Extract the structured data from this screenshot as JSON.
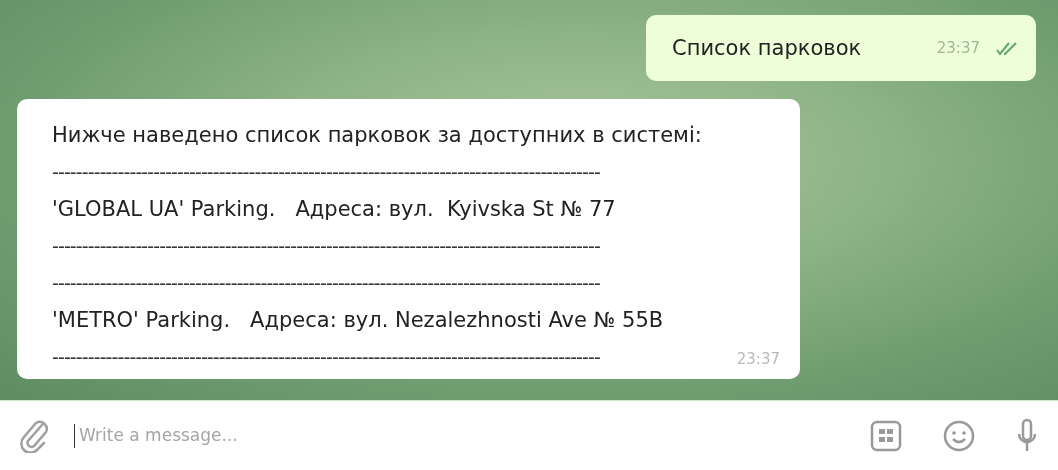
{
  "messages": [
    {
      "kind": "outgoing",
      "lines": [
        "Список парковок"
      ],
      "time": "23:37",
      "read": true
    },
    {
      "kind": "incoming",
      "lines": [
        "Нижче наведено список парковок за доступних в системі:",
        "--------------------------------------------------------------------------------------------",
        "'GLOBAL UA' Parking.   Адреса: вул.  Kyivska St № 77",
        "--------------------------------------------------------------------------------------------",
        "--------------------------------------------------------------------------------------------",
        "'METRO' Parking.   Адреса: вул. Nezalezhnosti Ave № 55B",
        "--------------------------------------------------------------------------------------------"
      ],
      "time": "23:37"
    }
  ],
  "composer": {
    "placeholder": "Write a message..."
  }
}
